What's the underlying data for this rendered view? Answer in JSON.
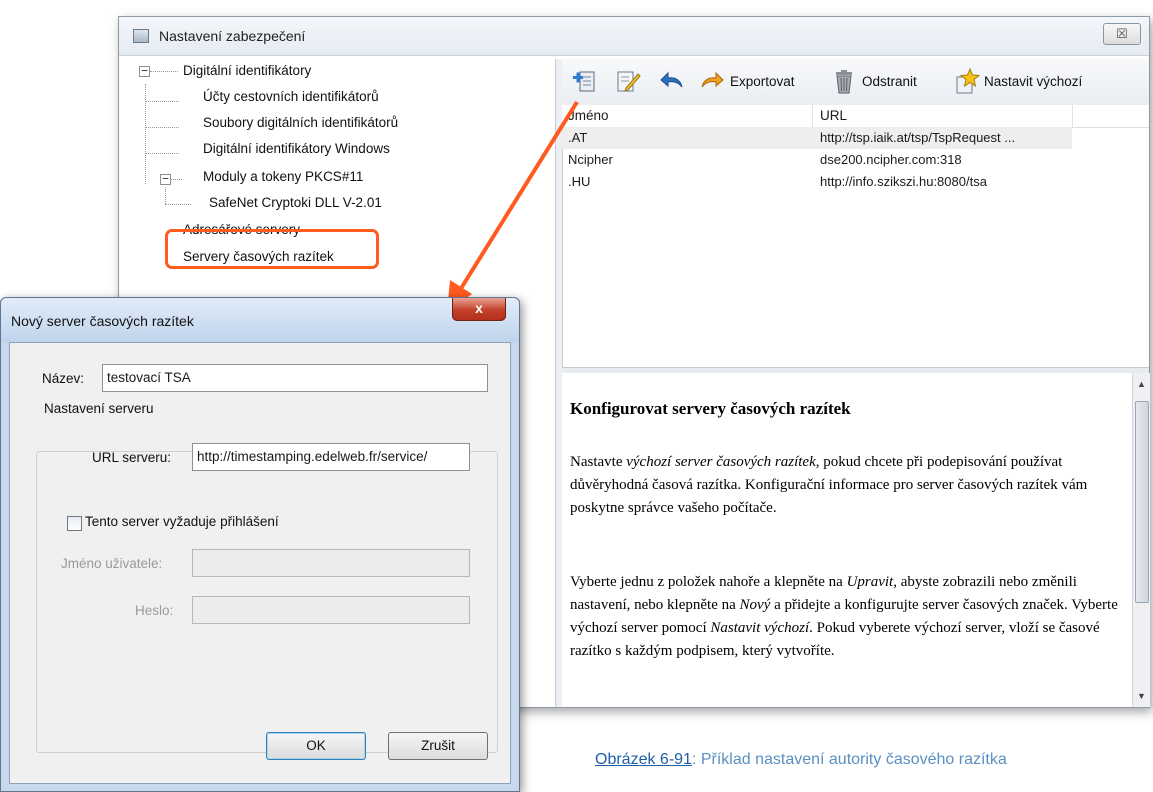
{
  "main_window": {
    "title": "Nastavení zabezpečení",
    "close_glyph": "☒"
  },
  "tree": {
    "items": [
      {
        "label": "Digitální identifikátory",
        "expander": "−"
      },
      {
        "label": "Účty cestovních identifikátorů"
      },
      {
        "label": "Soubory digitálních identifikátorů"
      },
      {
        "label": "Digitální identifikátory Windows"
      },
      {
        "label": "Moduly a tokeny PKCS#11",
        "expander": "−"
      },
      {
        "label": "SafeNet Cryptoki DLL V-2.01"
      },
      {
        "label": "Adresářové servery"
      },
      {
        "label": "Servery časových razítek"
      }
    ]
  },
  "toolbar": {
    "export_label": "Exportovat",
    "remove_label": "Odstranit",
    "set_default_label": "Nastavit výchozí"
  },
  "list": {
    "columns": [
      "Jméno",
      "URL"
    ],
    "rows": [
      {
        "name": ".AT",
        "url": "http://tsp.iaik.at/tsp/TspRequest ..."
      },
      {
        "name": "Ncipher",
        "url": "dse200.ncipher.com:318"
      },
      {
        "name": ".HU",
        "url": "http://info.szikszi.hu:8080/tsa"
      }
    ]
  },
  "help": {
    "heading": "Konfigurovat servery časových razítek",
    "p1_a": "Nastavte ",
    "p1_em": "výchozí server časových razítek",
    "p1_b": ", pokud chcete při podepisování používat důvěryhodná časová razítka. Konfigurační informace pro server časových razítek vám poskytne správce vašeho počítače.",
    "p2_a": "Vyberte jednu z položek nahoře a klepněte na ",
    "p2_em1": "Upravit",
    "p2_b": ", abyste zobrazili nebo změnili nastavení, nebo klepněte na ",
    "p2_em2": "Nový",
    "p2_c": " a přidejte a konfigurujte server časových značek. Vyberte výchozí server pomocí ",
    "p2_em3": "Nastavit výchozí",
    "p2_d": ". Pokud vyberete výchozí server, vloží se časové razítko s každým podpisem, který vytvoříte."
  },
  "dialog": {
    "title": "Nový server časových razítek",
    "close_glyph": "x",
    "name_label": "Název:",
    "name_value": "testovací TSA",
    "group_label": "Nastavení serveru",
    "url_label": "URL serveru:",
    "url_value": "http://timestamping.edelweb.fr/service/",
    "login_checkbox_label": "Tento server vyžaduje přihlášení",
    "login_checked": false,
    "username_label": "Jméno uživatele:",
    "username_value": "",
    "password_label": "Heslo:",
    "password_value": "",
    "ok_label": "OK",
    "cancel_label": "Zrušit"
  },
  "caption": {
    "link": "Obrázek 6-91",
    "text": ": Příklad nastavení autority časového razítka"
  },
  "colors": {
    "highlight_outline": "#ff5a1f",
    "arrow": "#ff5a1f",
    "caption": "#5a8fc0"
  }
}
